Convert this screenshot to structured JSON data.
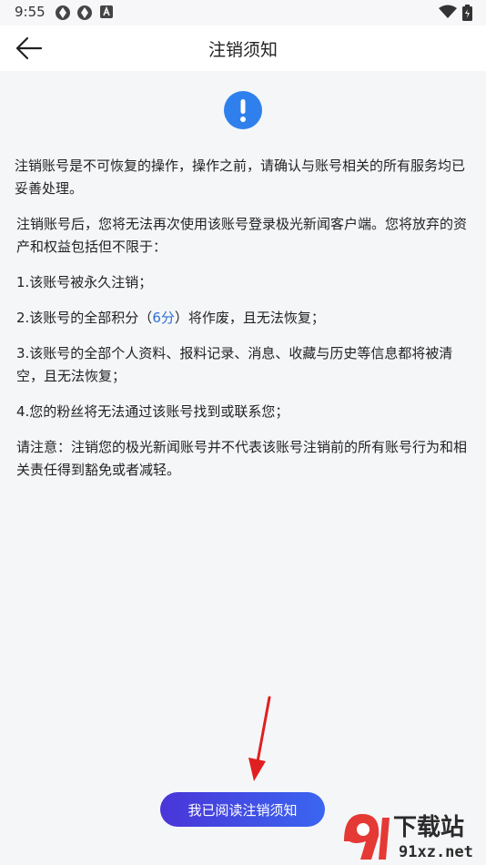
{
  "status": {
    "time": "9:55"
  },
  "header": {
    "title": "注销须知"
  },
  "notice": {
    "intro": "注销账号是不可恢复的操作，操作之前，请确认与账号相关的所有服务均已妥善处理。",
    "consequence": "注销账号后，您将无法再次使用该账号登录极光新闻客户端。您将放弃的资产和权益包括但不限于：",
    "item1": "1.该账号被永久注销；",
    "item2_prefix": "2.该账号的全部积分（",
    "item2_points": "6分",
    "item2_suffix": "）将作废，且无法恢复；",
    "item3": "3.该账号的全部个人资料、报料记录、消息、收藏与历史等信息都将被清空，且无法恢复；",
    "item4": "4.您的粉丝将无法通过该账号找到或联系您；",
    "note": "请注意：注销您的极光新闻账号并不代表该账号注销前的所有账号行为和相关责任得到豁免或者减轻。"
  },
  "footer": {
    "confirm_label": "我已阅读注销须知"
  },
  "watermark": {
    "logo_text": "下载站",
    "url": "91xz.net"
  },
  "colors": {
    "accent": "#3a66f0",
    "alert": "#2f80ed",
    "points": "#2f6fd6",
    "arrow": "#e02020"
  },
  "icons": {
    "back": "arrow-left-icon",
    "alert": "exclamation-circle-icon",
    "wifi": "wifi-icon",
    "battery": "battery-icon"
  }
}
